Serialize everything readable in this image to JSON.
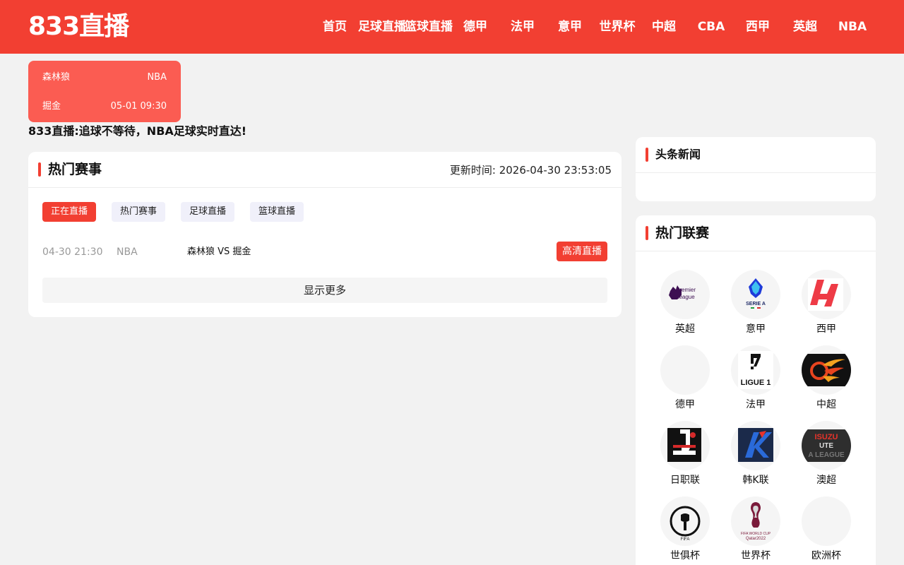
{
  "header": {
    "logo": "833直播",
    "nav": [
      "首页",
      "足球直播",
      "篮球直播",
      "德甲",
      "法甲",
      "意甲",
      "世界杯",
      "中超",
      "CBA",
      "西甲",
      "英超",
      "NBA"
    ]
  },
  "featured_match": {
    "home": "森林狼",
    "league": "NBA",
    "away": "掘金",
    "time": "05-01 09:30"
  },
  "slogan": "833直播:追球不等待，NBA足球实时直达!",
  "hot_events": {
    "title": "热门赛事",
    "update_label": "更新时间:",
    "update_time": "2026-04-30 23:53:05",
    "tabs": [
      "正在直播",
      "热门赛事",
      "足球直播",
      "篮球直播"
    ],
    "games": [
      {
        "time": "04-30 21:30",
        "league": "NBA",
        "teams": "森林狼 VS 掘金",
        "button": "高清直播"
      }
    ],
    "more_label": "显示更多"
  },
  "news": {
    "title": "头条新闻"
  },
  "leagues": {
    "title": "热门联赛",
    "items": [
      {
        "name": "英超",
        "icon": "premier-league-logo"
      },
      {
        "name": "意甲",
        "icon": "serie-a-logo"
      },
      {
        "name": "西甲",
        "icon": "laliga-logo"
      },
      {
        "name": "德甲",
        "icon": "bundesliga-logo"
      },
      {
        "name": "法甲",
        "icon": "ligue1-logo"
      },
      {
        "name": "中超",
        "icon": "csl-logo"
      },
      {
        "name": "日职联",
        "icon": "j-league-logo"
      },
      {
        "name": "韩K联",
        "icon": "k-league-logo"
      },
      {
        "name": "澳超",
        "icon": "a-league-logo"
      },
      {
        "name": "世俱杯",
        "icon": "club-world-cup-logo"
      },
      {
        "name": "世界杯",
        "icon": "world-cup-logo"
      },
      {
        "name": "欧洲杯",
        "icon": "euro-logo"
      }
    ],
    "logo_text": {
      "premier_1": "Premier",
      "premier_2": "League",
      "serie_a": "SERIE A",
      "ligue1": "LIGUE 1",
      "isuzu": "ISUZU",
      "ute": "UTE",
      "aleague": "A LEAGUE",
      "club_wc": "CLUB WORLD CUP 25",
      "fifa": "FIFA",
      "fifa_wc": "FIFA WORLD CUP",
      "qatar": "Qatar2022"
    }
  },
  "colors": {
    "primary": "#f23f32",
    "card": "#fb5c52",
    "background": "#f2f2f2"
  }
}
